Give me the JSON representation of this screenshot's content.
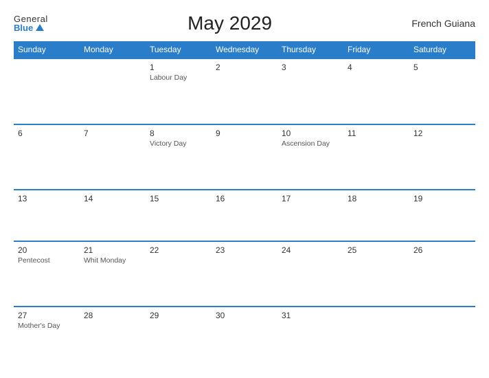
{
  "header": {
    "logo_general": "General",
    "logo_blue": "Blue",
    "title": "May 2029",
    "region": "French Guiana"
  },
  "days_of_week": [
    "Sunday",
    "Monday",
    "Tuesday",
    "Wednesday",
    "Thursday",
    "Friday",
    "Saturday"
  ],
  "weeks": [
    [
      {
        "day": "",
        "holiday": ""
      },
      {
        "day": "",
        "holiday": ""
      },
      {
        "day": "1",
        "holiday": "Labour Day"
      },
      {
        "day": "2",
        "holiday": ""
      },
      {
        "day": "3",
        "holiday": ""
      },
      {
        "day": "4",
        "holiday": ""
      },
      {
        "day": "5",
        "holiday": ""
      }
    ],
    [
      {
        "day": "6",
        "holiday": ""
      },
      {
        "day": "7",
        "holiday": ""
      },
      {
        "day": "8",
        "holiday": "Victory Day"
      },
      {
        "day": "9",
        "holiday": ""
      },
      {
        "day": "10",
        "holiday": "Ascension Day"
      },
      {
        "day": "11",
        "holiday": ""
      },
      {
        "day": "12",
        "holiday": ""
      }
    ],
    [
      {
        "day": "13",
        "holiday": ""
      },
      {
        "day": "14",
        "holiday": ""
      },
      {
        "day": "15",
        "holiday": ""
      },
      {
        "day": "16",
        "holiday": ""
      },
      {
        "day": "17",
        "holiday": ""
      },
      {
        "day": "18",
        "holiday": ""
      },
      {
        "day": "19",
        "holiday": ""
      }
    ],
    [
      {
        "day": "20",
        "holiday": "Pentecost"
      },
      {
        "day": "21",
        "holiday": "Whit Monday"
      },
      {
        "day": "22",
        "holiday": ""
      },
      {
        "day": "23",
        "holiday": ""
      },
      {
        "day": "24",
        "holiday": ""
      },
      {
        "day": "25",
        "holiday": ""
      },
      {
        "day": "26",
        "holiday": ""
      }
    ],
    [
      {
        "day": "27",
        "holiday": "Mother's Day"
      },
      {
        "day": "28",
        "holiday": ""
      },
      {
        "day": "29",
        "holiday": ""
      },
      {
        "day": "30",
        "holiday": ""
      },
      {
        "day": "31",
        "holiday": ""
      },
      {
        "day": "",
        "holiday": ""
      },
      {
        "day": "",
        "holiday": ""
      }
    ]
  ]
}
